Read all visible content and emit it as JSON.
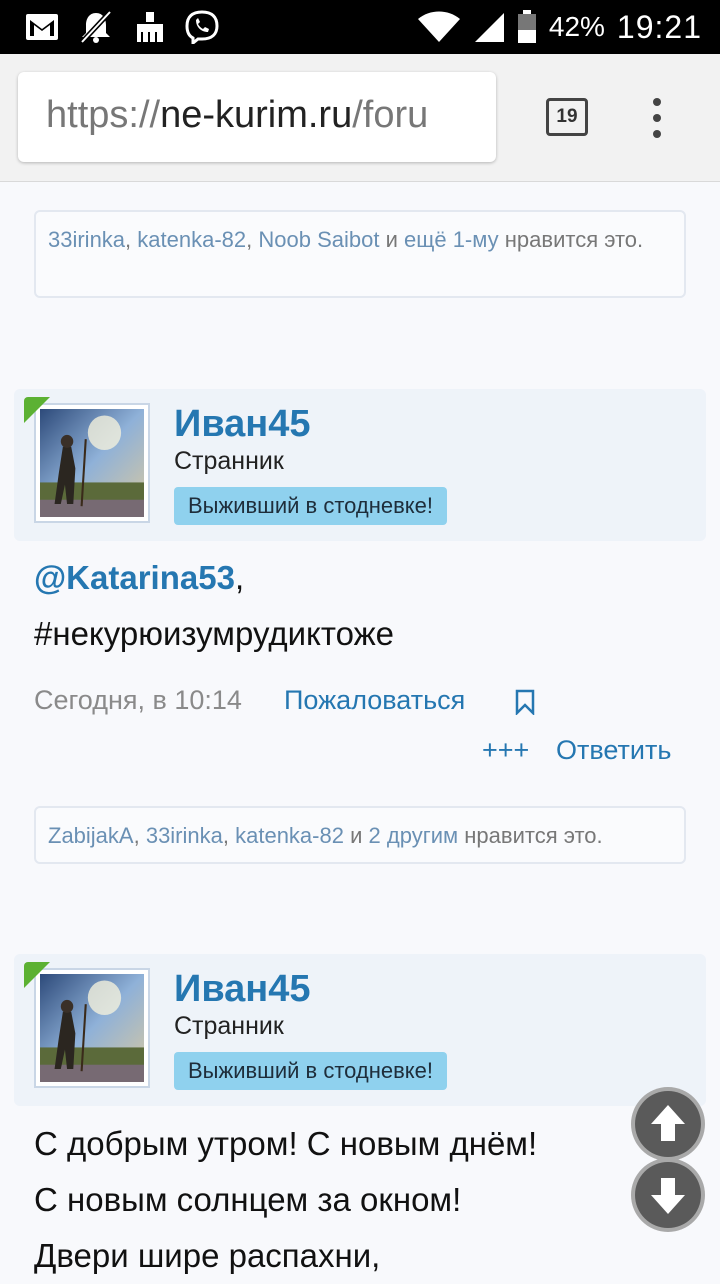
{
  "status": {
    "battery": "42%",
    "time": "19:21"
  },
  "browser": {
    "url_scheme": "https://",
    "url_host": "ne-kurim.ru",
    "url_path": "/foru",
    "tab_count": "19"
  },
  "likes_top": {
    "users": [
      "33irinka",
      "katenka-82",
      "Noob Saibot"
    ],
    "sep": ", ",
    "and": "и",
    "more": "ещё 1-му",
    "suffix": "нравится",
    "suffix2": "это."
  },
  "post1": {
    "author": "Иван45",
    "title": "Странник",
    "badge": "Выживший в стодневке!",
    "mention": "@Katarina53",
    "comma": ",",
    "line2": "#некурюизумрудиктоже",
    "date": "Сегодня, в 10:14",
    "report": "Пожаловаться",
    "plus": "+++",
    "reply": "Ответить"
  },
  "likes_mid": {
    "users": [
      "ZabijakA",
      "33irinka",
      "katenka-82"
    ],
    "sep": ", ",
    "and": "и",
    "more": "2 другим",
    "suffix": "нравится это."
  },
  "post2": {
    "author": "Иван45",
    "title": "Странник",
    "badge": "Выживший в стодневке!",
    "lines": [
      "С добрым утром! С новым днём!",
      "С новым солнцем за окном!",
      "Двери шире распахни,"
    ]
  },
  "icons": {
    "gmail": "gmail-icon",
    "mute": "notifications-off-icon",
    "cleaner": "cleaner-icon",
    "viber": "viber-icon",
    "wifi": "wifi-icon",
    "signal": "signal-icon",
    "battery": "battery-icon"
  }
}
